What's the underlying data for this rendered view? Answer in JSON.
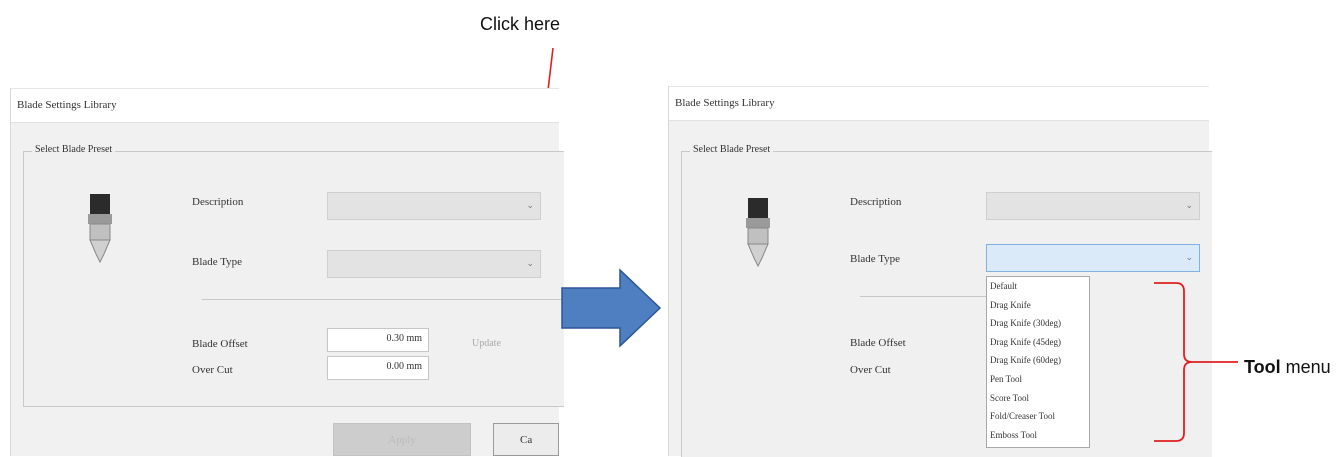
{
  "annotations": {
    "click_here": "Click here",
    "tool_menu_bold": "Tool",
    "tool_menu_rest": " menu"
  },
  "dialog_left": {
    "title": "Blade Settings Library",
    "group_title": "Select Blade Preset",
    "description_label": "Description",
    "blade_type_label": "Blade Type",
    "blade_offset_label": "Blade Offset",
    "blade_offset_value": "0.30 mm",
    "over_cut_label": "Over Cut",
    "over_cut_value": "0.00 mm",
    "update_label": "Update",
    "apply_label": "Apply",
    "cancel_label": "Ca"
  },
  "dialog_right": {
    "title": "Blade Settings Library",
    "group_title": "Select Blade Preset",
    "description_label": "Description",
    "blade_type_label": "Blade Type",
    "blade_offset_label": "Blade Offset",
    "over_cut_label": "Over Cut",
    "blade_type_options": [
      "Default",
      "Drag Knife",
      "Drag Knife (30deg)",
      "Drag Knife (45deg)",
      "Drag Knife (60deg)",
      "Pen Tool",
      "Score Tool",
      "Fold/Creaser Tool",
      "Emboss Tool"
    ]
  },
  "colors": {
    "arrow_red": "#e02020",
    "bracket_red": "#e02020",
    "flow_arrow_fill": "#4f7fc1",
    "flow_arrow_stroke": "#2f5597",
    "combo_active": "#dbeaf8"
  }
}
